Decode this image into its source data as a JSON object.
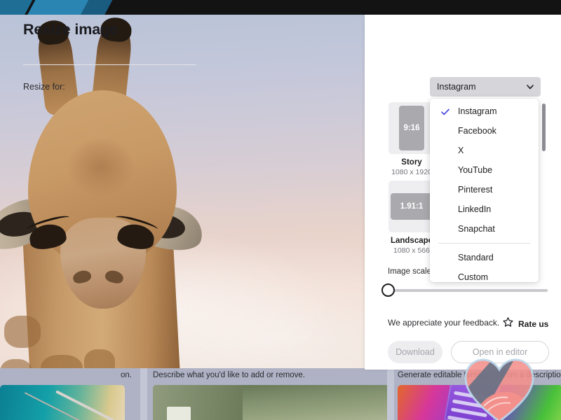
{
  "panel": {
    "title": "Resize image",
    "resize_for_label": "Resize for:",
    "selected_preset": "Instagram",
    "chevron_icon": "chevron-down-icon",
    "scale_label": "Image scale",
    "feedback_text": "We appreciate your feedback.",
    "rate_us_label": "Rate us",
    "rate_us_icon": "star-outline-icon",
    "download_label": "Download",
    "open_in_editor_label": "Open in editor"
  },
  "ratios": [
    {
      "ratio": "9:16",
      "name": "Story",
      "dims": "1080 x 1920"
    },
    {
      "ratio": "1.91:1",
      "name": "Landscape",
      "dims": "1080 x 566"
    }
  ],
  "dropdown": {
    "check_icon": "check-icon",
    "items": [
      {
        "label": "Instagram",
        "selected": true
      },
      {
        "label": "Facebook",
        "selected": false
      },
      {
        "label": "X",
        "selected": false
      },
      {
        "label": "YouTube",
        "selected": false
      },
      {
        "label": "Pinterest",
        "selected": false
      },
      {
        "label": "LinkedIn",
        "selected": false
      },
      {
        "label": "Snapchat",
        "selected": false
      },
      {
        "label": "Standard",
        "selected": false
      },
      {
        "label": "Custom",
        "selected": false
      }
    ]
  },
  "gallery": {
    "cards": [
      {
        "caption": "on."
      },
      {
        "caption": "Describe what you'd like to add or remove."
      },
      {
        "caption": "Generate editable templates from a description."
      }
    ]
  },
  "colors": {
    "accent_check": "#4a4ae0",
    "panel_bg": "#ffffff",
    "combo_bg": "#d6d6da",
    "topbar": "#131314"
  },
  "watermark": {
    "icon": "heart-handshake-watermark"
  }
}
